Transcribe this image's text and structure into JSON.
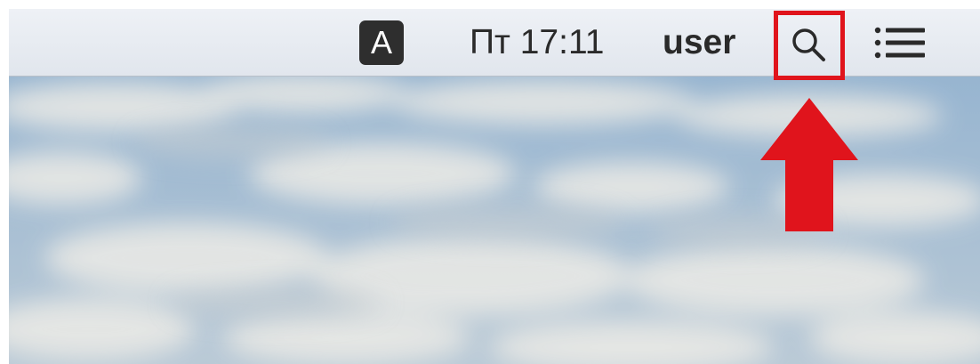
{
  "menubar": {
    "input_source_label": "A",
    "clock_text": "Пт 17:11",
    "user_name": "user",
    "search_icon": "magnifying-glass",
    "menu_icon": "list-icon"
  },
  "annotation": {
    "highlight_color": "#e0141c",
    "arrow_color": "#e0141c",
    "points_to": "spotlight-search-button"
  },
  "colors": {
    "menubar_bg": "#e6eaef",
    "sky": "#a8c0d6",
    "clouds": "#e6e6e2"
  }
}
